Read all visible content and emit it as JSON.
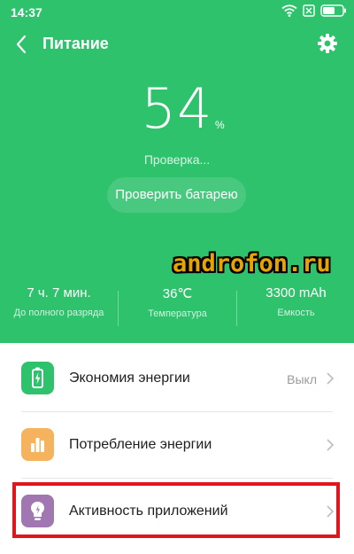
{
  "status_bar": {
    "time": "14:37",
    "icons": [
      "wifi-icon",
      "sim-off-icon",
      "battery-icon"
    ]
  },
  "app_bar": {
    "title": "Питание",
    "back_icon": "chevron-left-icon",
    "settings_icon": "gear-icon"
  },
  "battery": {
    "percent": "54",
    "unit": "%",
    "status": "Проверка...",
    "check_button": "Проверить батарею"
  },
  "stats": [
    {
      "value": "7 ч. 7 мин.",
      "label": "До полного разряда"
    },
    {
      "value": "36℃",
      "label": "Температура"
    },
    {
      "value": "3300 mAh",
      "label": "Емкость"
    }
  ],
  "menu": [
    {
      "label": "Экономия энергии",
      "value": "Выкл",
      "icon": "battery-saver-icon",
      "color": "#2ec26c"
    },
    {
      "label": "Потребление энергии",
      "value": "",
      "icon": "bar-chart-icon",
      "color": "#f5b35e"
    },
    {
      "label": "Активность приложений",
      "value": "",
      "icon": "lightbulb-icon",
      "color": "#a077b0"
    }
  ],
  "watermark": "androfon.ru",
  "colors": {
    "header_bg": "#2ec26c",
    "highlight_border": "#e0161c",
    "watermark": "#e6a400"
  }
}
